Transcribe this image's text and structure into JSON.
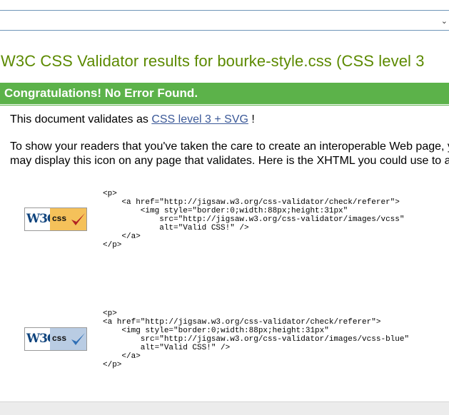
{
  "header": {
    "chevron_glyph": "⌄"
  },
  "page": {
    "title": "W3C CSS Validator results for bourke-style.css (CSS level 3"
  },
  "banner": {
    "text": "Congratulations! No Error Found."
  },
  "validation": {
    "prefix": "This document validates as ",
    "profile_link": "CSS level 3 + SVG",
    "suffix": " !"
  },
  "readers_text": "To show your readers that you've taken the care to create an interoperable Web page, you may display this icon on any page that validates. Here is the XHTML you could use to add this icon to your Web page:",
  "badges": [
    {
      "w3c_text": "W3C",
      "css_text": "css",
      "panel_color": "#f5c15a",
      "check_color": "#b22222",
      "code": "<p>\n    <a href=\"http://jigsaw.w3.org/css-validator/check/referer\">\n        <img style=\"border:0;width:88px;height:31px\"\n            src=\"http://jigsaw.w3.org/css-validator/images/vcss\"\n            alt=\"Valid CSS!\" />\n    </a>\n</p>"
    },
    {
      "w3c_text": "W3C",
      "css_text": "css",
      "panel_color": "#b9cce3",
      "check_color": "#2f6fb5",
      "code": "<p>\n<a href=\"http://jigsaw.w3.org/css-validator/check/referer\">\n    <img style=\"border:0;width:88px;height:31px\"\n        src=\"http://jigsaw.w3.org/css-validator/images/vcss-blue\"\n        alt=\"Valid CSS!\" />\n    </a>\n</p>"
    }
  ]
}
